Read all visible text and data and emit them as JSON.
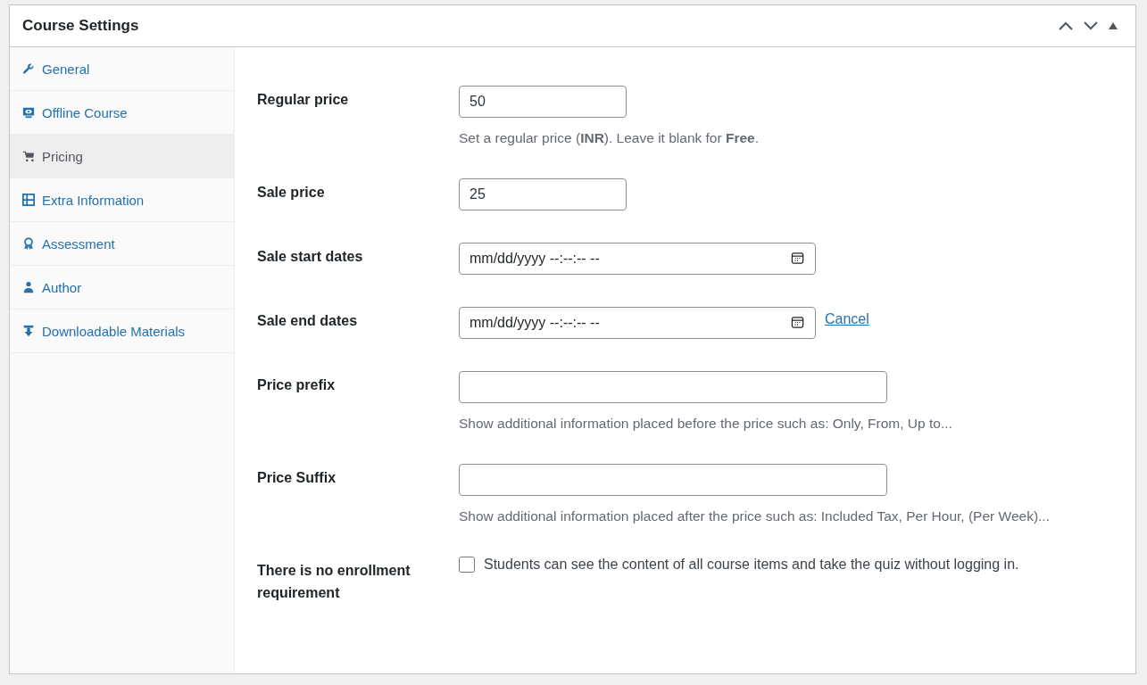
{
  "panel": {
    "title": "Course Settings"
  },
  "tabs": [
    {
      "label": "General",
      "selected": false
    },
    {
      "label": "Offline Course",
      "selected": false
    },
    {
      "label": "Pricing",
      "selected": true
    },
    {
      "label": "Extra Information",
      "selected": false
    },
    {
      "label": "Assessment",
      "selected": false
    },
    {
      "label": "Author",
      "selected": false
    },
    {
      "label": "Downloadable Materials",
      "selected": false
    }
  ],
  "fields": [
    {
      "kind": "text",
      "label": "Regular price",
      "value": "50",
      "description": "Set a regular price (**INR**). Leave it blank for **Free**."
    },
    {
      "kind": "text",
      "label": "Sale price",
      "value": "25"
    },
    {
      "kind": "datetime",
      "label": "Sale start dates",
      "placeholder": "mm/dd/yyyy --:--:-- --"
    },
    {
      "kind": "datetime",
      "label": "Sale end dates",
      "placeholder": "mm/dd/yyyy --:--:-- --",
      "link": "Cancel"
    },
    {
      "kind": "wide",
      "label": "Price prefix",
      "description": "Show additional information placed before the price such as: Only, From, Up to..."
    },
    {
      "kind": "wide",
      "label": "Price Suffix",
      "description": "Show additional information placed after the price such as: Included Tax, Per Hour, (Per Week)..."
    },
    {
      "kind": "checkbox",
      "label": "There is no enrollment requirement",
      "text": "Students can see the content of all course items and take the quiz without logging in.",
      "checked": false
    }
  ]
}
